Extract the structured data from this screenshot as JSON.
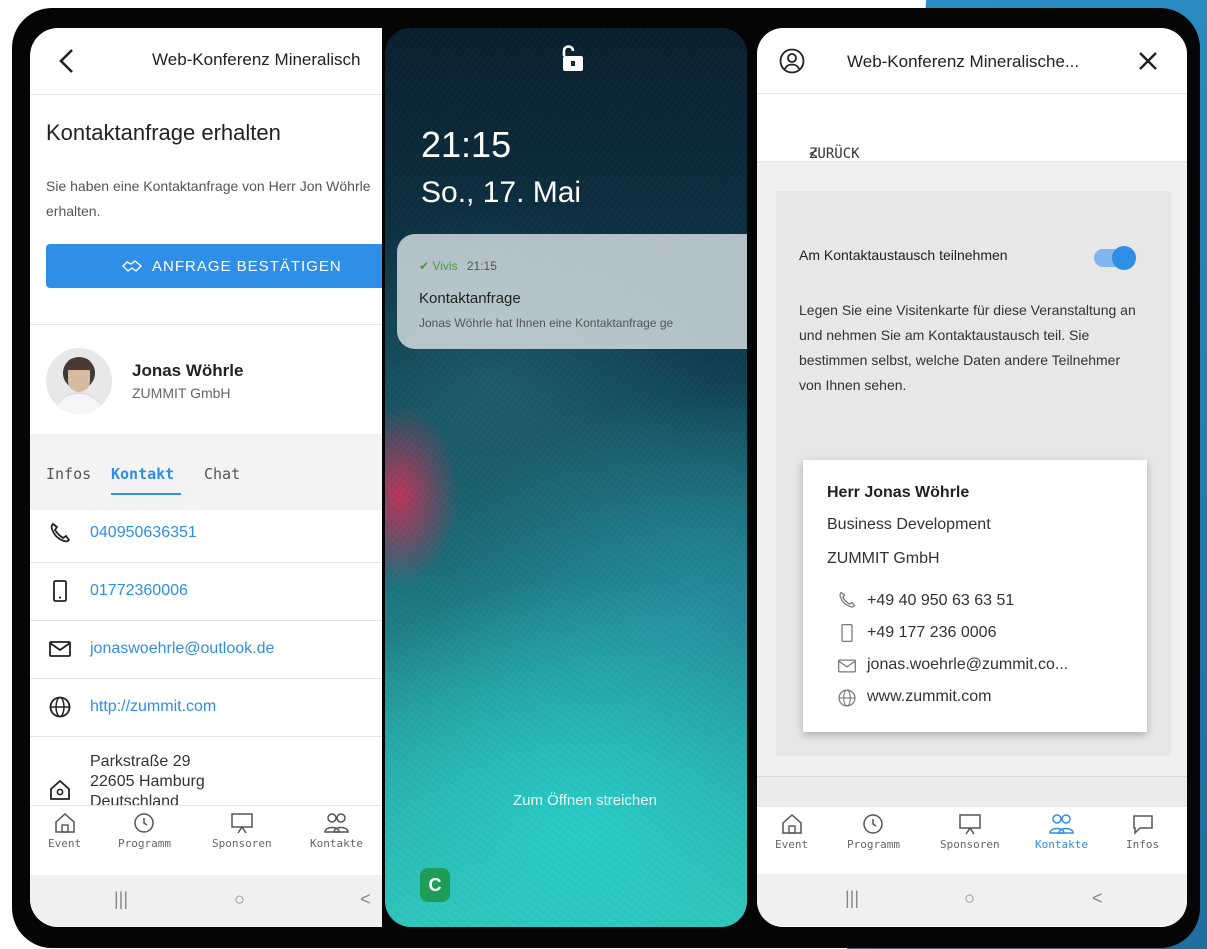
{
  "phone1": {
    "header_title": "Web-Konferenz Mineralisch",
    "heading": "Kontaktanfrage erhalten",
    "message": "Sie haben eine Kontaktanfrage von Herr Jon Wöhrle erhalten.",
    "confirm_button": "ANFRAGE BESTÄTIGEN",
    "person": {
      "name": "Jonas Wöhrle",
      "company": "ZUMMIT GmbH"
    },
    "tabs": [
      {
        "label": "Infos"
      },
      {
        "label": "Kontakt",
        "active": true
      },
      {
        "label": "Chat"
      }
    ],
    "contacts": [
      {
        "icon": "phone-icon",
        "value": "040950636351"
      },
      {
        "icon": "mobile-icon",
        "value": "01772360006"
      },
      {
        "icon": "mail-icon",
        "value": "jonaswoehrle@outlook.de"
      },
      {
        "icon": "globe-icon",
        "value": "http://zummit.com"
      }
    ],
    "address": {
      "street": "Parkstraße 29",
      "city": "22605 Hamburg",
      "country": "Deutschland"
    },
    "bottom_nav": [
      {
        "label": "Event",
        "icon": "home-icon"
      },
      {
        "label": "Programm",
        "icon": "clock-icon"
      },
      {
        "label": "Sponsoren",
        "icon": "presentation-icon"
      },
      {
        "label": "Kontakte",
        "icon": "people-icon"
      }
    ]
  },
  "phone2": {
    "time": "21:15",
    "date": "So., 17. Mai",
    "notification": {
      "app": "Vivis",
      "time": "21:15",
      "title": "Kontaktanfrage",
      "body": "Jonas Wöhrle hat Ihnen eine Kontaktanfrage ge"
    },
    "swipe_hint": "Zum Öffnen streichen",
    "badge": "C"
  },
  "phone3": {
    "header_title": "Web-Konferenz Mineralische...",
    "back_label": "ZURÜCK",
    "toggle_label": "Am Kontaktaustausch teilnehmen",
    "toggle_on": true,
    "description": "Legen Sie eine Visitenkarte für diese Veranstaltung an und nehmen Sie am Kontaktaustausch teil. Sie bestimmen selbst, welche Daten andere Teilnehmer von Ihnen sehen.",
    "card": {
      "name": "Herr Jonas Wöhrle",
      "role": "Business Development",
      "company": "ZUMMIT GmbH",
      "phone": "+49 40 950 63 63 51",
      "mobile": "+49 177 236 0006",
      "email": "jonas.woehrle@zummit.co...",
      "web": "www.zummit.com"
    },
    "bottom_nav": [
      {
        "label": "Event",
        "icon": "home-icon"
      },
      {
        "label": "Programm",
        "icon": "clock-icon"
      },
      {
        "label": "Sponsoren",
        "icon": "presentation-icon"
      },
      {
        "label": "Kontakte",
        "icon": "people-icon",
        "active": true
      },
      {
        "label": "Infos",
        "icon": "chat-icon"
      }
    ]
  },
  "colors": {
    "accent": "#2f8ee5",
    "frame": "#050505",
    "corner": "#2b8fc4"
  }
}
